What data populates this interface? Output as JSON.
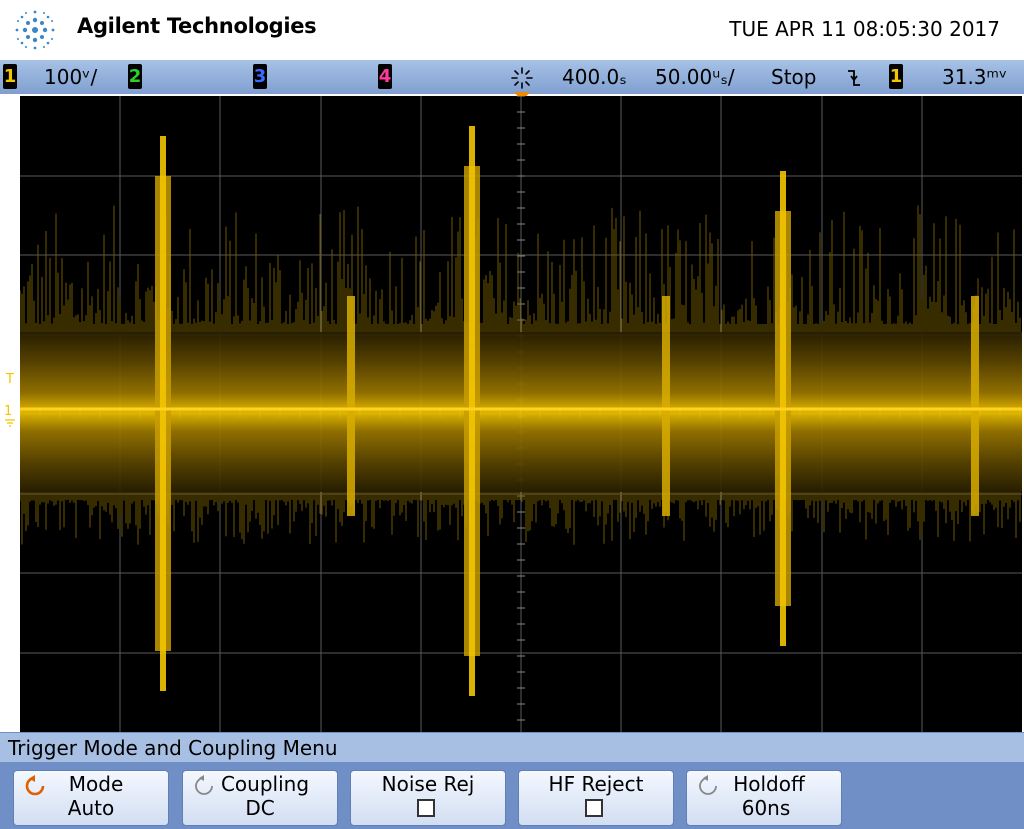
{
  "header": {
    "brand": "Agilent Technologies",
    "datetime": "TUE APR 11 08:05:30 2017"
  },
  "status": {
    "ch1_num": "1",
    "ch1_scale": "100ᵛ/",
    "ch2_num": "2",
    "ch3_num": "3",
    "ch4_num": "4",
    "time_delay": "400.0ₛ",
    "time_scale": "50.00ᵘₛ/",
    "run_state": "Stop",
    "trigger_source": "1",
    "trigger_level": "31.3ᵐᵛ",
    "colors": {
      "ch1": "#f2c500",
      "ch2": "#2bd12b",
      "ch3": "#3a6cff",
      "ch4": "#ff3a9a"
    }
  },
  "screen": {
    "trigger_marker": "T",
    "ch1_marker": "1"
  },
  "menu": {
    "title": "Trigger Mode and Coupling Menu",
    "softkeys": [
      {
        "label": "Mode",
        "value": "Auto"
      },
      {
        "label": "Coupling",
        "value": "DC"
      },
      {
        "label": "Noise Rej",
        "value": ""
      },
      {
        "label": "HF Reject",
        "value": ""
      },
      {
        "label": "Holdoff",
        "value": "60ns"
      }
    ]
  }
}
